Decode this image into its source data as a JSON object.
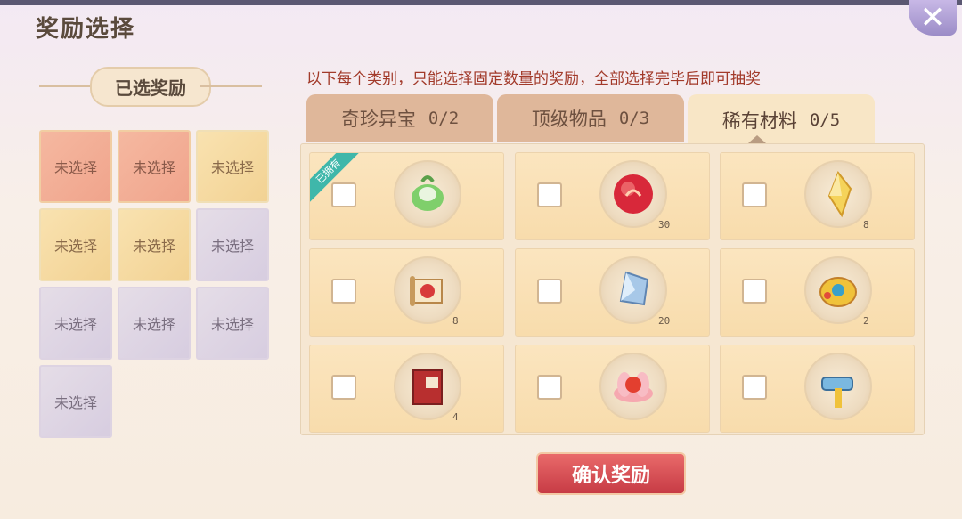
{
  "title": "奖励选择",
  "close_icon": "close-icon",
  "left": {
    "header": "已选奖励",
    "slots": [
      {
        "label": "未选择",
        "tone": "red"
      },
      {
        "label": "未选择",
        "tone": "red"
      },
      {
        "label": "未选择",
        "tone": "gold"
      },
      {
        "label": "未选择",
        "tone": "gold"
      },
      {
        "label": "未选择",
        "tone": "gold"
      },
      {
        "label": "未选择",
        "tone": "purple"
      },
      {
        "label": "未选择",
        "tone": "purple"
      },
      {
        "label": "未选择",
        "tone": "purple"
      },
      {
        "label": "未选择",
        "tone": "purple"
      },
      {
        "label": "未选择",
        "tone": "purple"
      }
    ]
  },
  "instruction": "以下每个类别，只能选择固定数量的奖励，全部选择完毕后即可抽奖",
  "tabs": [
    {
      "label": "奇珍异宝",
      "count": "0/2",
      "active": false
    },
    {
      "label": "顶级物品",
      "count": "0/3",
      "active": false
    },
    {
      "label": "稀有材料",
      "count": "0/5",
      "active": true
    }
  ],
  "items": [
    {
      "icon": "green-pouch-icon",
      "qty": "",
      "owned": true,
      "owned_label": "已拥有"
    },
    {
      "icon": "red-orb-icon",
      "qty": "30",
      "owned": false
    },
    {
      "icon": "yellow-crystal-icon",
      "qty": "8",
      "owned": false
    },
    {
      "icon": "scroll-icon",
      "qty": "8",
      "owned": false
    },
    {
      "icon": "blue-crystal-icon",
      "qty": "20",
      "owned": false
    },
    {
      "icon": "golden-artifact-icon",
      "qty": "2",
      "owned": false
    },
    {
      "icon": "red-book-icon",
      "qty": "4",
      "owned": false
    },
    {
      "icon": "lotus-icon",
      "qty": "",
      "owned": false
    },
    {
      "icon": "hammer-icon",
      "qty": "",
      "owned": false
    }
  ],
  "confirm_label": "确认奖励",
  "colors": {
    "accent": "#c73b45",
    "instruction": "#a23a2a",
    "owned_ribbon": "#3fb7aa"
  }
}
